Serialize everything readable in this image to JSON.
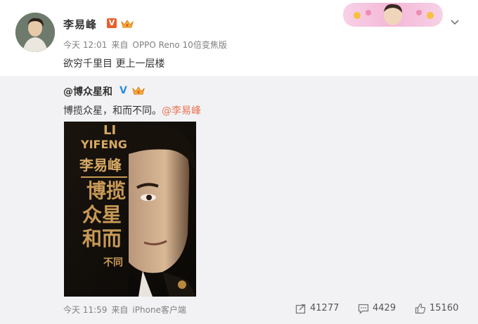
{
  "post": {
    "author": "李易峰",
    "verified_badge": "V",
    "time": "今天 12:01",
    "source_prefix": "来自",
    "source": "OPPO Reno 10倍变焦版",
    "text": "欲穷千里目 更上一层楼"
  },
  "repost": {
    "author": "@博众星和",
    "verified_badge": "V",
    "text": "博揽众星，和而不同。",
    "mention": "@李易峰",
    "poster": {
      "line1": "LI",
      "line2": "YIFENG",
      "line3": "李易峰",
      "line4": "博揽",
      "line5": "众星",
      "line6": "和而",
      "line7": "不同"
    },
    "time": "今天 11:59",
    "source_prefix": "来自",
    "source": "iPhone客户端",
    "actions": {
      "forward_count": "41277",
      "comment_count": "4429",
      "like_count": "15160"
    }
  },
  "colors": {
    "accent": "#eb7350",
    "verified_orange": "#e8612d",
    "verified_blue": "#2a8ee0",
    "poster_gold": "#c89a57"
  },
  "icons": [
    "crown-icon",
    "chevron-down-icon",
    "forward-icon",
    "comment-icon",
    "like-icon"
  ]
}
